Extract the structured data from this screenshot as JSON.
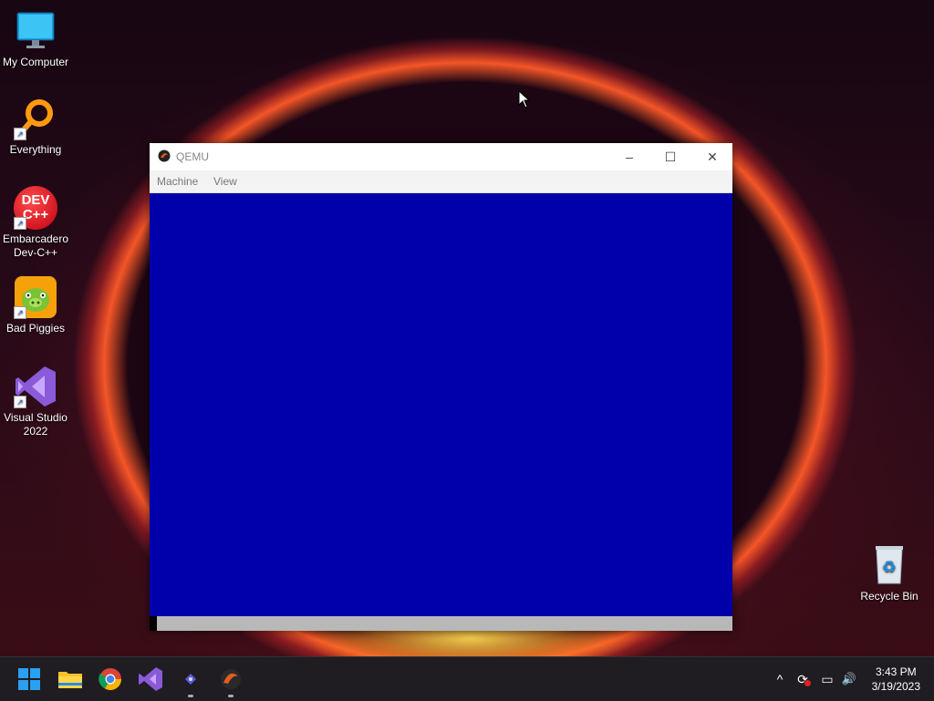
{
  "desktop": {
    "icons": [
      {
        "label": "My Computer"
      },
      {
        "label": "Everything"
      },
      {
        "label": "Embarcadero Dev-C++"
      },
      {
        "label": "Bad Piggies"
      },
      {
        "label": "Visual Studio 2022"
      },
      {
        "label": "Recycle Bin"
      }
    ],
    "devcpp_icon_text": "DEV C++"
  },
  "window": {
    "title": "QEMU",
    "menu": [
      "Machine",
      "View"
    ],
    "screen_color": "#0000AA",
    "controls": {
      "minimize": "–",
      "maximize": "☐",
      "close": "✕"
    }
  },
  "taskbar": {
    "apps": [
      "start-icon",
      "file-explorer-icon",
      "chrome-icon",
      "visual-studio-icon",
      "terminal-app-icon",
      "qemu-icon"
    ],
    "tray": {
      "chevron": "^",
      "sync": "⟳",
      "network": "▭",
      "volume": "🔊"
    },
    "clock": {
      "time": "3:43 PM",
      "date": "3/19/2023"
    }
  }
}
